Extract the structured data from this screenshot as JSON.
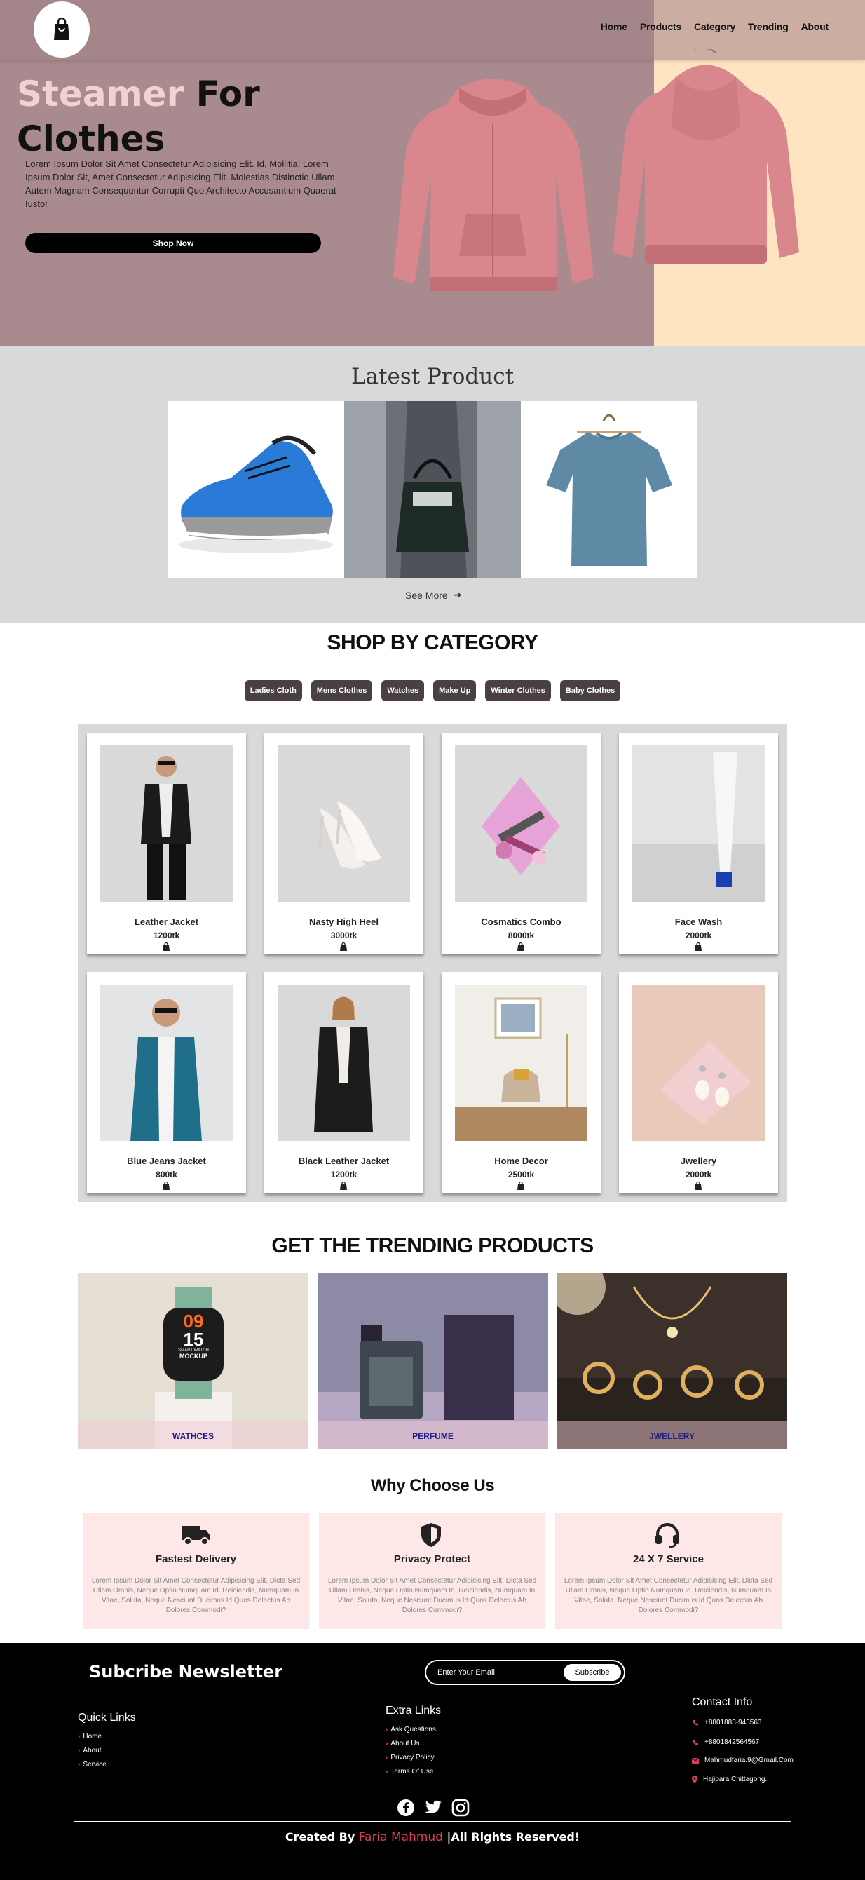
{
  "nav": {
    "links": [
      "Home",
      "Products",
      "Category",
      "Trending",
      "About"
    ]
  },
  "hero": {
    "title_pink": "Steamer",
    "title_rest": " For Clothes",
    "text": "Lorem Ipsum Dolor Sit Amet Consectetur Adipisicing Elit. Id, Mollitia! Lorem Ipsum Dolor Sit, Amet Consectetur Adipisicing Elit. Molestias Distinctio Ullam Autem Magnam Consequuntur Corrupti Quo Architecto Accusantium Quaerat Iusto!",
    "button": "Shop Now"
  },
  "latest": {
    "title": "Latest Product",
    "see_more": "See More"
  },
  "category": {
    "title": "SHOP BY CATEGORY",
    "chips": [
      "Ladies Cloth",
      "Mens Clothes",
      "Watches",
      "Make Up",
      "Winter Clothes",
      "Baby Clothes"
    ],
    "products": [
      {
        "name": "Leather Jacket",
        "price": "1200tk"
      },
      {
        "name": "Nasty High Heel",
        "price": "3000tk"
      },
      {
        "name": "Cosmatics Combo",
        "price": "8000tk"
      },
      {
        "name": "Face Wash",
        "price": "2000tk"
      },
      {
        "name": "Blue Jeans Jacket",
        "price": "800tk"
      },
      {
        "name": "Black Leather Jacket",
        "price": "1200tk"
      },
      {
        "name": "Home Decor",
        "price": "2500tk"
      },
      {
        "name": "Jwellery",
        "price": "2000tk"
      }
    ]
  },
  "trending": {
    "title": "GET THE TRENDING PRODUCTS",
    "items": [
      "WATHCES",
      "PERFUME",
      "JWELLERY"
    ],
    "watch_screen": [
      "09",
      "15",
      "SMART WATCH",
      "MOCKUP"
    ]
  },
  "why": {
    "title": "Why Choose Us",
    "cards": [
      {
        "title": "Fastest Delivery",
        "text": "Lorem Ipsum Dolor Sit Amet Consectetur Adipisicing Elit. Dicta Sed Ullam Omnis, Neque Optio Numquam Id. Reiciendis, Numquam In Vitae, Soluta, Neque Nesciunt Ducimus Id Quos Delectus Ab Dolores Commodi?"
      },
      {
        "title": "Privacy Protect",
        "text": "Lorem Ipsum Dolor Sit Amet Consectetur Adipisicing Elit. Dicta Sed Ullam Omnis, Neque Optio Numquam Id. Reiciendis, Numquam In Vitae, Soluta, Neque Nesciunt Ducimus Id Quos Delectus Ab Dolores Commodi?"
      },
      {
        "title": "24 X 7 Service",
        "text": "Lorem Ipsum Dolor Sit Amet Consectetur Adipisicing Elit. Dicta Sed Ullam Omnis, Neque Optio Numquam Id. Reiciendis, Numquam In Vitae, Soluta, Neque Nesciunt Ducimus Id Quos Delectus Ab Dolores Commodi?"
      }
    ]
  },
  "footer": {
    "newsletter": "Subcribe Newsletter",
    "email_placeholder": "Enter Your Email",
    "subscribe": "Subscribe",
    "quick_links_title": "Quick Links",
    "quick_links": [
      "Home",
      "About",
      "Service"
    ],
    "extra_links_title": "Extra Links",
    "extra_links": [
      "Ask Questions",
      "About Us",
      "Privacy Policy",
      "Terms Of Use"
    ],
    "contact_title": "Contact Info",
    "contacts": [
      "+8801883-943563",
      "+8801842564567",
      "Mahmudfaria.9@Gmail.Com",
      "Hajipara Chittagong."
    ],
    "credit_prefix": "Created By ",
    "credit_author": "Faria Mahmud",
    "credit_suffix": " |All Rights Reserved!"
  },
  "colors": {
    "hero_bg": "#a88a8f",
    "hero_accent": "#ffe4c2",
    "pink_text": "#f5d0d3",
    "chip_bg": "#4a4042",
    "why_card_bg": "#fde7e7",
    "author_red": "#e03a5a"
  }
}
